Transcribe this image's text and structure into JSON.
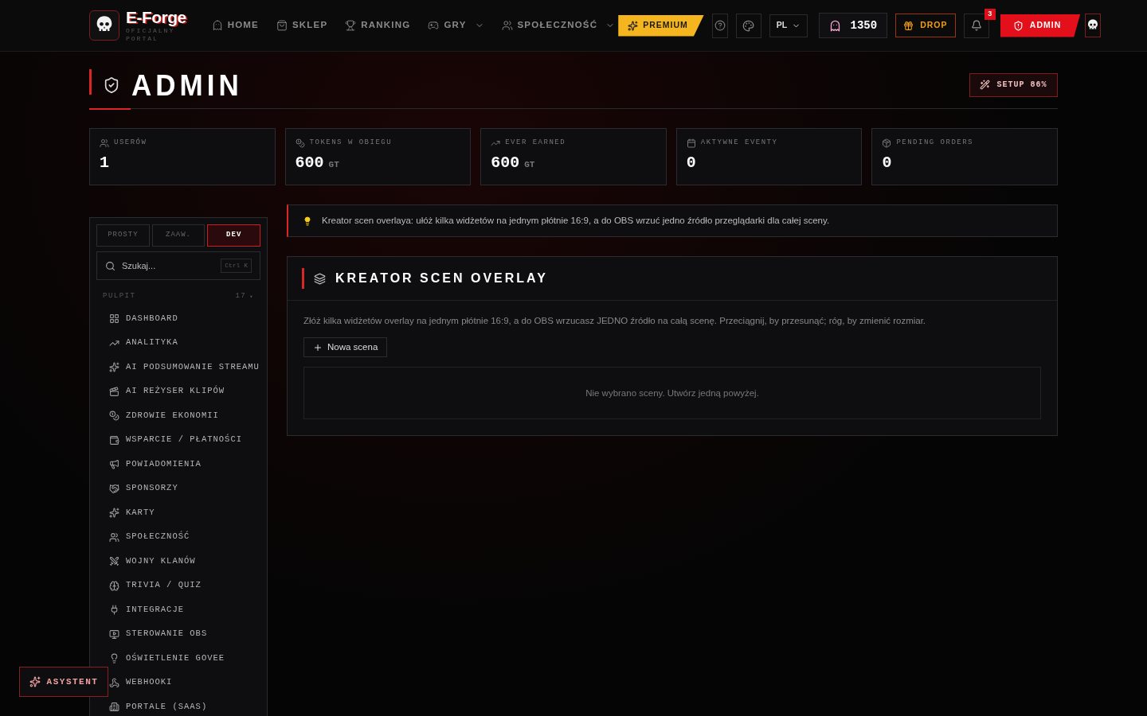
{
  "brand": {
    "name": "E-Forge",
    "tagline": "OFICJALNY PORTAL"
  },
  "nav": [
    {
      "label": "HOME",
      "has_menu": false
    },
    {
      "label": "SKLEP",
      "has_menu": false
    },
    {
      "label": "RANKING",
      "has_menu": false
    },
    {
      "label": "GRY",
      "has_menu": true
    },
    {
      "label": "SPOŁECZNOŚĆ",
      "has_menu": true
    }
  ],
  "header_actions": {
    "premium": "PREMIUM",
    "language": "PL",
    "tokens": "1350",
    "drop": "DROP",
    "notifications": "3",
    "admin": "ADMIN"
  },
  "page": {
    "title": "ADMIN",
    "setup": "SETUP 86%"
  },
  "stats": [
    {
      "label": "USERÓW",
      "value": "1"
    },
    {
      "label": "TOKENS W OBIEGU",
      "value": "600",
      "unit": "GT"
    },
    {
      "label": "EVER EARNED",
      "value": "600",
      "unit": "GT"
    },
    {
      "label": "AKTYWNE EVENTY",
      "value": "0"
    },
    {
      "label": "PENDING ORDERS",
      "value": "0"
    }
  ],
  "sidebar": {
    "modes": [
      {
        "label": "PROSTY",
        "selected": false
      },
      {
        "label": "ZAAW.",
        "selected": false
      },
      {
        "label": "DEV",
        "selected": true
      }
    ],
    "search": {
      "placeholder": "Szukaj...",
      "shortcut": "Ctrl K"
    },
    "section": {
      "title": "PULPIT",
      "count": "17",
      "caret": "▾"
    },
    "items": [
      {
        "label": "DASHBOARD"
      },
      {
        "label": "ANALITYKA"
      },
      {
        "label": "AI PODSUMOWANIE STREAMU"
      },
      {
        "label": "AI REŻYSER KLIPÓW"
      },
      {
        "label": "ZDROWIE EKONOMII"
      },
      {
        "label": "WSPARCIE / PŁATNOŚCI"
      },
      {
        "label": "POWIADOMIENIA"
      },
      {
        "label": "SPONSORZY"
      },
      {
        "label": "KARTY"
      },
      {
        "label": "SPOŁECZNOŚĆ"
      },
      {
        "label": "WOJNY KLANÓW"
      },
      {
        "label": "TRIVIA / QUIZ"
      },
      {
        "label": "INTEGRACJE"
      },
      {
        "label": "STEROWANIE OBS"
      },
      {
        "label": "OŚWIETLENIE GOVEE"
      },
      {
        "label": "WEBHOOKI"
      },
      {
        "label": "PORTALE (SAAS)"
      }
    ]
  },
  "tip": "Kreator scen overlaya: ułóż kilka widżetów na jednym płótnie 16:9, a do OBS wrzuć jedno źródło przeglądarki dla całej sceny.",
  "panel": {
    "title": "KREATOR SCEN OVERLAY",
    "description": "Złóż kilka widżetów overlay na jednym płótnie 16:9, a do OBS wrzucasz JEDNO źródło na całą scenę. Przeciągnij, by przesunąć; róg, by zmienić rozmiar.",
    "new_button": "Nowa scena",
    "empty": "Nie wybrano sceny. Utwórz jedną powyżej."
  },
  "assistant": "ASYSTENT"
}
